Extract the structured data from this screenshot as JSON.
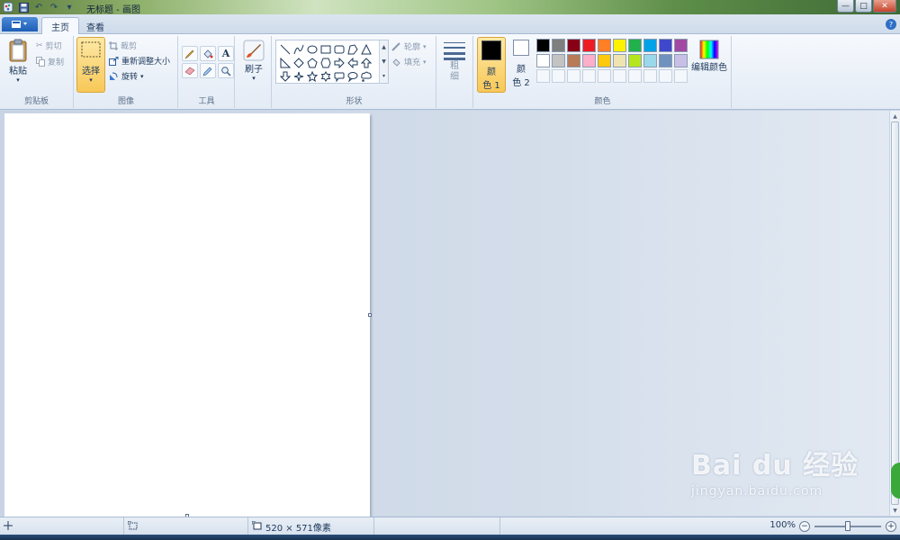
{
  "window": {
    "title": "无标题 - 画图",
    "controls": [
      "—",
      "□",
      "✕"
    ]
  },
  "tabs": [
    {
      "label": "主页",
      "active": true
    },
    {
      "label": "查看",
      "active": false
    }
  ],
  "ribbon": {
    "clipboard": {
      "label": "剪贴板",
      "paste": "粘贴",
      "cut": "剪切",
      "copy": "复制"
    },
    "image": {
      "label": "图像",
      "select": "选择",
      "crop": "裁剪",
      "resize": "重新调整大小",
      "rotate": "旋转"
    },
    "tools": {
      "label": "工具",
      "items": [
        "pencil-icon",
        "fill-icon",
        "text-icon",
        "eraser-icon",
        "color-picker-icon",
        "magnifier-icon"
      ]
    },
    "brushes": {
      "label": "刷子"
    },
    "shapes": {
      "label": "形状",
      "outline": "轮廓",
      "fill": "填充"
    },
    "size": {
      "label": "粗细"
    },
    "colors": {
      "label": "颜色",
      "color1": {
        "label_line1": "颜",
        "label_line2": "色 1",
        "value": "#000000"
      },
      "color2": {
        "label_line1": "颜",
        "label_line2": "色 2",
        "value": "#ffffff"
      },
      "edit": "编辑颜色",
      "palette_row1": [
        "#000000",
        "#7f7f7f",
        "#880015",
        "#ed1c24",
        "#ff7f27",
        "#fff200",
        "#22b14c",
        "#00a2e8",
        "#3f48cc",
        "#a349a4"
      ],
      "palette_row2": [
        "#ffffff",
        "#c3c3c3",
        "#b97a57",
        "#ffaec9",
        "#ffc90e",
        "#efe4b0",
        "#b5e61d",
        "#99d9ea",
        "#7092be",
        "#c8bfe7"
      ]
    }
  },
  "status": {
    "canvas_size": "520 × 571像素",
    "zoom": "100%",
    "zoom_level": 0.5
  },
  "watermark": {
    "main": "Bai du 经验",
    "sub": "jingyan.baidu.com"
  }
}
